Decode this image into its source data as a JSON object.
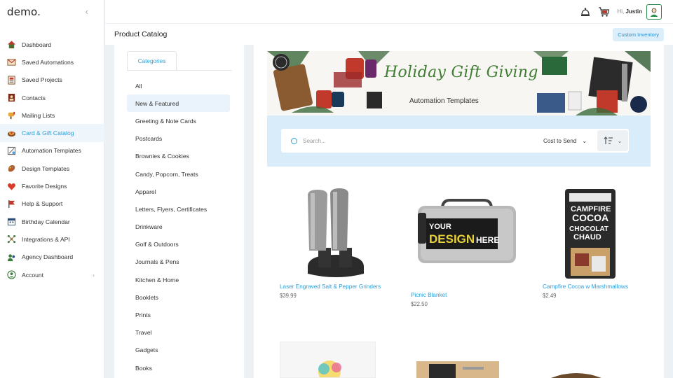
{
  "app": {
    "logo": "demo.",
    "collapse_icon": "chevron-left-icon"
  },
  "sidebar": {
    "items": [
      {
        "label": "Dashboard",
        "icon": "house-icon"
      },
      {
        "label": "Saved Automations",
        "icon": "automation-icon"
      },
      {
        "label": "Saved Projects",
        "icon": "projects-icon"
      },
      {
        "label": "Contacts",
        "icon": "contacts-icon"
      },
      {
        "label": "Mailing Lists",
        "icon": "mailing-icon"
      },
      {
        "label": "Card & Gift Catalog",
        "icon": "gift-icon",
        "active": true
      },
      {
        "label": "Automation Templates",
        "icon": "templates-icon"
      },
      {
        "label": "Design Templates",
        "icon": "palette-icon"
      },
      {
        "label": "Favorite Designs",
        "icon": "heart-icon"
      },
      {
        "label": "Help & Support",
        "icon": "flag-icon"
      },
      {
        "label": "Birthday Calendar",
        "icon": "calendar-icon"
      },
      {
        "label": "Integrations & API",
        "icon": "integrations-icon"
      },
      {
        "label": "Agency Dashboard",
        "icon": "agency-icon"
      },
      {
        "label": "Account",
        "icon": "account-icon",
        "chevron": "›"
      }
    ]
  },
  "topbar": {
    "greeting_prefix": "Hi,",
    "user_name": "Justin"
  },
  "page": {
    "title": "Product Catalog",
    "custom_inventory_label": "Custom Inventory"
  },
  "categories": {
    "tab_label": "Categories",
    "items": [
      "All",
      "New & Featured",
      "Greeting & Note Cards",
      "Postcards",
      "Brownies & Cookies",
      "Candy, Popcorn, Treats",
      "Apparel",
      "Letters, Flyers, Certificates",
      "Drinkware",
      "Golf & Outdoors",
      "Journals & Pens",
      "Kitchen & Home",
      "Booklets",
      "Prints",
      "Travel",
      "Gadgets",
      "Books"
    ],
    "active_index": 1
  },
  "banner": {
    "title": "Holiday Gift Giving",
    "subtitle": "Automation Templates"
  },
  "search": {
    "placeholder": "Search...",
    "sort_label": "Cost to Send"
  },
  "products": [
    {
      "name": "Laser Engraved Salt & Pepper Grinders",
      "price": "$39.99"
    },
    {
      "name": "Picnic Blanket",
      "price": "$22.50"
    },
    {
      "name": "Campfire Cocoa w Marshmallows",
      "price": "$2.49"
    }
  ],
  "product_images": {
    "blanket_text_1": "YOUR",
    "blanket_text_2": "DESIGN",
    "blanket_text_3": "HERE",
    "cocoa_text_1": "CAMPFIRE",
    "cocoa_text_2": "COCOA",
    "cocoa_text_3": "CHOCOLAT",
    "cocoa_text_4": "CHAUD"
  },
  "colors": {
    "accent": "#2a9fd8",
    "banner_green": "#3f7d33",
    "search_bg": "#d9ecf9"
  }
}
